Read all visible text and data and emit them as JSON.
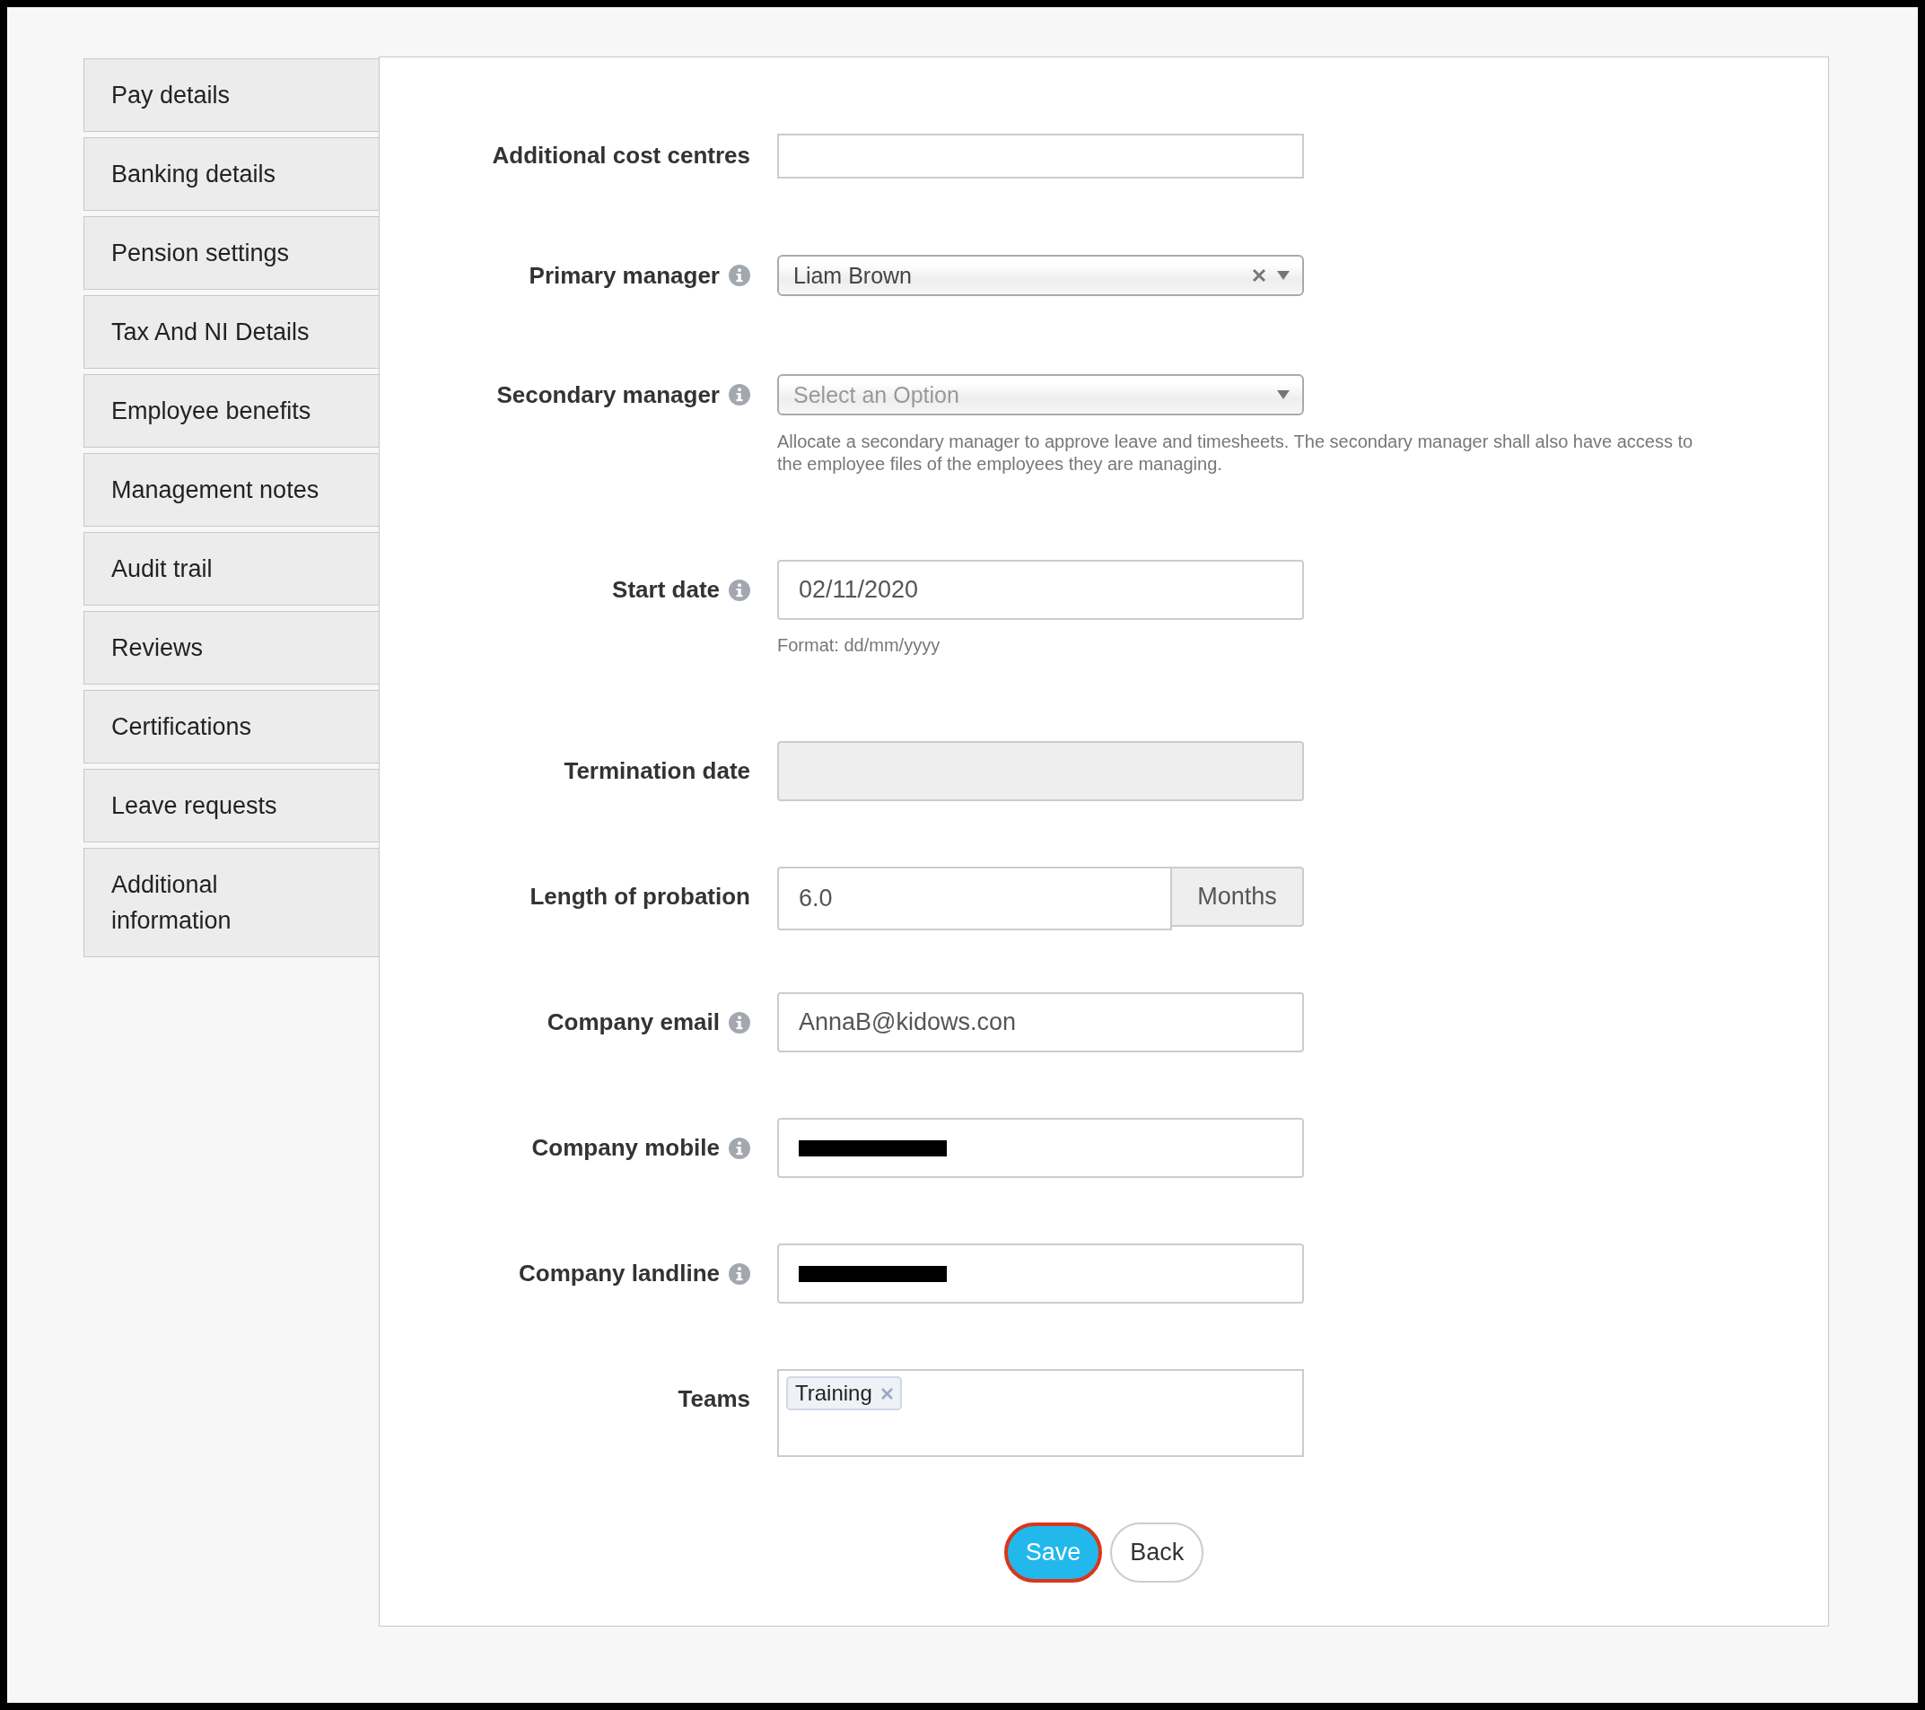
{
  "sidebar": {
    "items": [
      {
        "label": "Pay details"
      },
      {
        "label": "Banking details"
      },
      {
        "label": "Pension settings"
      },
      {
        "label": "Tax And NI Details"
      },
      {
        "label": "Employee benefits"
      },
      {
        "label": "Management notes"
      },
      {
        "label": "Audit trail"
      },
      {
        "label": "Reviews"
      },
      {
        "label": "Certifications"
      },
      {
        "label": "Leave requests"
      },
      {
        "label": "Additional information"
      }
    ]
  },
  "form": {
    "fields": [
      {
        "kind": "multi-select",
        "label": "Additional cost centres",
        "info": false,
        "disabled": false
      },
      {
        "kind": "select",
        "label": "Primary manager",
        "info": true,
        "disabled": false,
        "value": "Liam Brown",
        "clearable": true
      },
      {
        "kind": "select",
        "label": "Secondary manager",
        "info": true,
        "disabled": false,
        "placeholder": "Select an Option",
        "clearable": false,
        "help": "Allocate a secondary manager to approve leave and timesheets. The secondary manager shall also have access to the employee files of the employees they are managing."
      },
      {
        "kind": "input",
        "label": "Start date",
        "info": true,
        "disabled": false,
        "value": "02/11/2020",
        "help": "Format: dd/mm/yyyy"
      },
      {
        "kind": "input",
        "label": "Termination date",
        "info": false,
        "disabled": true
      },
      {
        "kind": "addon",
        "label": "Length of probation",
        "info": false,
        "disabled": false,
        "value": "6.0",
        "addon": "Months"
      },
      {
        "kind": "input",
        "label": "Company email",
        "info": true,
        "disabled": false,
        "value": "AnnaB@kidows.con"
      },
      {
        "kind": "redacted",
        "label": "Company mobile",
        "info": true,
        "disabled": false
      },
      {
        "kind": "redacted",
        "label": "Company landline",
        "info": true,
        "disabled": false
      },
      {
        "kind": "tags",
        "label": "Teams",
        "info": false,
        "disabled": false,
        "tags": [
          "Training"
        ]
      }
    ]
  },
  "buttons": [
    {
      "kind": "primary",
      "label": "Save"
    },
    {
      "kind": "secondary",
      "label": "Back"
    }
  ]
}
